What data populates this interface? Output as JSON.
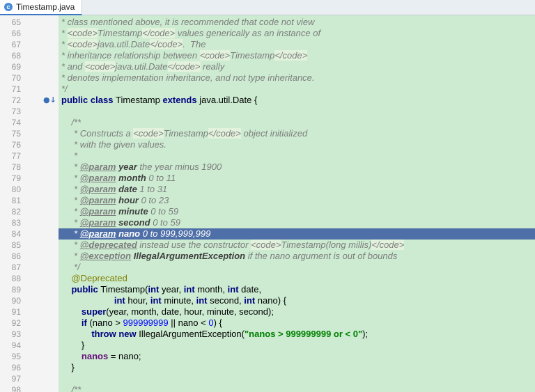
{
  "tab": {
    "icon": "class-icon",
    "label": "Timestamp.java"
  },
  "lines": [
    {
      "num": "65",
      "segs": [
        [
          "c",
          "* class mentioned above, it is recommended that code not view"
        ]
      ]
    },
    {
      "num": "66",
      "segs": [
        [
          "c",
          "* "
        ],
        [
          "tag",
          "<code>"
        ],
        [
          "c",
          "Timestamp"
        ],
        [
          "tag",
          "</code>"
        ],
        [
          "c",
          " values generically as an instance of"
        ]
      ]
    },
    {
      "num": "67",
      "segs": [
        [
          "c",
          "* "
        ],
        [
          "tag",
          "<code>"
        ],
        [
          "c",
          "java.util.Date"
        ],
        [
          "tag",
          "</code>"
        ],
        [
          "c",
          ".  The"
        ]
      ]
    },
    {
      "num": "68",
      "segs": [
        [
          "c",
          "* inheritance relationship between "
        ],
        [
          "tag",
          "<code>"
        ],
        [
          "c",
          "Timestamp"
        ],
        [
          "tag",
          "</code>"
        ]
      ]
    },
    {
      "num": "69",
      "segs": [
        [
          "c",
          "* and "
        ],
        [
          "tag",
          "<code>"
        ],
        [
          "c",
          "java.util.Date"
        ],
        [
          "tag",
          "</code>"
        ],
        [
          "c",
          " really"
        ]
      ]
    },
    {
      "num": "70",
      "segs": [
        [
          "c",
          "* denotes implementation inheritance, and not type inheritance."
        ]
      ]
    },
    {
      "num": "71",
      "segs": [
        [
          "c",
          "*/"
        ]
      ]
    },
    {
      "num": "72",
      "mark": "●↓",
      "segs": [
        [
          "k",
          "public class "
        ],
        [
          "i",
          "Timestamp "
        ],
        [
          "k",
          "extends "
        ],
        [
          "i",
          "java.util.Date {"
        ]
      ]
    },
    {
      "num": "73",
      "segs": []
    },
    {
      "num": "74",
      "segs": [
        [
          "c",
          "    /**"
        ]
      ]
    },
    {
      "num": "75",
      "segs": [
        [
          "c",
          "     * Constructs a "
        ],
        [
          "tag",
          "<code>"
        ],
        [
          "c",
          "Timestamp"
        ],
        [
          "tag",
          "</code>"
        ],
        [
          "c",
          " object initialized"
        ]
      ]
    },
    {
      "num": "76",
      "segs": [
        [
          "c",
          "     * with the given values."
        ]
      ]
    },
    {
      "num": "77",
      "segs": [
        [
          "c",
          "     *"
        ]
      ]
    },
    {
      "num": "78",
      "segs": [
        [
          "c",
          "     * "
        ],
        [
          "dt",
          "@param"
        ],
        [
          "c",
          " "
        ],
        [
          "dn",
          "year"
        ],
        [
          "c",
          " the year minus 1900"
        ]
      ]
    },
    {
      "num": "79",
      "segs": [
        [
          "c",
          "     * "
        ],
        [
          "dt",
          "@param"
        ],
        [
          "c",
          " "
        ],
        [
          "dn",
          "month"
        ],
        [
          "c",
          " 0 to 11"
        ]
      ]
    },
    {
      "num": "80",
      "segs": [
        [
          "c",
          "     * "
        ],
        [
          "dt",
          "@param"
        ],
        [
          "c",
          " "
        ],
        [
          "dn",
          "date"
        ],
        [
          "c",
          " 1 to 31"
        ]
      ]
    },
    {
      "num": "81",
      "segs": [
        [
          "c",
          "     * "
        ],
        [
          "dt",
          "@param"
        ],
        [
          "c",
          " "
        ],
        [
          "dn",
          "hour"
        ],
        [
          "c",
          " 0 to 23"
        ]
      ]
    },
    {
      "num": "82",
      "segs": [
        [
          "c",
          "     * "
        ],
        [
          "dt",
          "@param"
        ],
        [
          "c",
          " "
        ],
        [
          "dn",
          "minute"
        ],
        [
          "c",
          " 0 to 59"
        ]
      ]
    },
    {
      "num": "83",
      "segs": [
        [
          "c",
          "     * "
        ],
        [
          "dt",
          "@param"
        ],
        [
          "c",
          " "
        ],
        [
          "dn",
          "second"
        ],
        [
          "c",
          " 0 to 59"
        ]
      ]
    },
    {
      "num": "84",
      "selected": true,
      "segs": [
        [
          "c",
          "     * "
        ],
        [
          "dt",
          "@param"
        ],
        [
          "c",
          " "
        ],
        [
          "dn",
          "nano"
        ],
        [
          "c",
          " 0 to 999,999,999"
        ]
      ]
    },
    {
      "num": "85",
      "segs": [
        [
          "c",
          "     * "
        ],
        [
          "dt",
          "@deprecated"
        ],
        [
          "c",
          " instead use the constructor "
        ],
        [
          "tag",
          "<code>"
        ],
        [
          "c",
          "Timestamp(long millis)"
        ],
        [
          "tag",
          "</code>"
        ]
      ]
    },
    {
      "num": "86",
      "segs": [
        [
          "c",
          "     * "
        ],
        [
          "dt",
          "@exception"
        ],
        [
          "c",
          " "
        ],
        [
          "dn",
          "IllegalArgumentException"
        ],
        [
          "c",
          " if the nano argument is out of bounds"
        ]
      ]
    },
    {
      "num": "87",
      "segs": [
        [
          "c",
          "     */"
        ]
      ]
    },
    {
      "num": "88",
      "segs": [
        [
          "a",
          "    @Deprecated"
        ]
      ]
    },
    {
      "num": "89",
      "segs": [
        [
          "k",
          "    public "
        ],
        [
          "i",
          "Timestamp("
        ],
        [
          "k",
          "int "
        ],
        [
          "i",
          "year, "
        ],
        [
          "k",
          "int "
        ],
        [
          "i",
          "month, "
        ],
        [
          "k",
          "int "
        ],
        [
          "i",
          "date,"
        ]
      ]
    },
    {
      "num": "90",
      "segs": [
        [
          "k",
          "                     int "
        ],
        [
          "i",
          "hour, "
        ],
        [
          "k",
          "int "
        ],
        [
          "i",
          "minute, "
        ],
        [
          "k",
          "int "
        ],
        [
          "i",
          "second, "
        ],
        [
          "k",
          "int "
        ],
        [
          "i",
          "nano) {"
        ]
      ]
    },
    {
      "num": "91",
      "segs": [
        [
          "k",
          "        super"
        ],
        [
          "i",
          "(year, month, date, hour, minute, second);"
        ]
      ]
    },
    {
      "num": "92",
      "segs": [
        [
          "k",
          "        if "
        ],
        [
          "i",
          "(nano > "
        ],
        [
          "n",
          "999999999"
        ],
        [
          "i",
          " || nano < "
        ],
        [
          "n",
          "0"
        ],
        [
          "i",
          ") {"
        ]
      ]
    },
    {
      "num": "93",
      "segs": [
        [
          "k",
          "            throw new "
        ],
        [
          "i",
          "IllegalArgumentException("
        ],
        [
          "s",
          "\"nanos > 999999999 or < 0\""
        ],
        [
          "i",
          ");"
        ]
      ]
    },
    {
      "num": "94",
      "segs": [
        [
          "i",
          "        }"
        ]
      ]
    },
    {
      "num": "95",
      "segs": [
        [
          "f",
          "        nanos"
        ],
        [
          "i",
          " = nano;"
        ]
      ]
    },
    {
      "num": "96",
      "segs": [
        [
          "i",
          "    }"
        ]
      ]
    },
    {
      "num": "97",
      "segs": []
    },
    {
      "num": "98",
      "segs": [
        [
          "c",
          "    /**"
        ]
      ]
    }
  ]
}
